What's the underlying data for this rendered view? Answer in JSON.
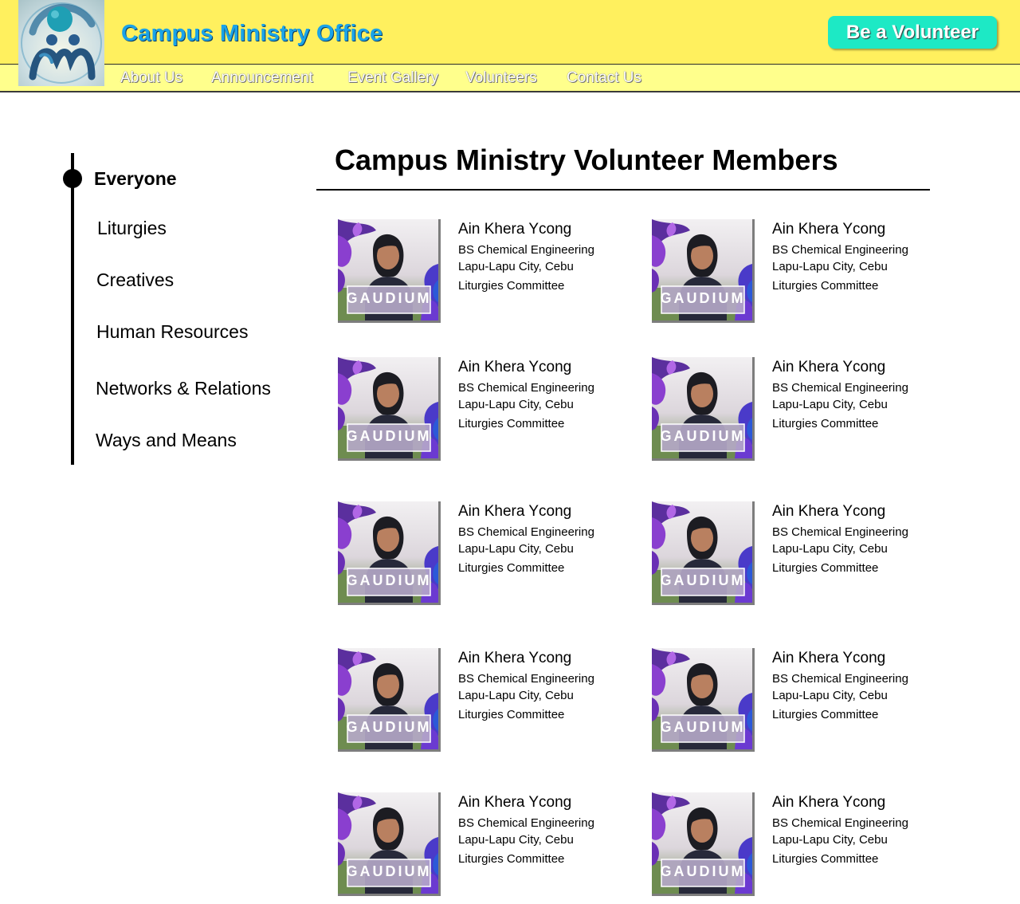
{
  "header": {
    "site_title": "Campus Ministry Office",
    "cta_label": "Be a Volunteer",
    "logo_icon": "campus-ministry-logo-icon"
  },
  "nav": [
    {
      "label": "About Us"
    },
    {
      "label": "Announcement"
    },
    {
      "label": "Event Gallery"
    },
    {
      "label": "Volunteers"
    },
    {
      "label": "Contact Us"
    }
  ],
  "sidebar": {
    "items": [
      {
        "label": "Everyone",
        "active": true
      },
      {
        "label": "Liturgies",
        "active": false
      },
      {
        "label": "Creatives",
        "active": false
      },
      {
        "label": "Human Resources",
        "active": false
      },
      {
        "label": "Networks & Relations",
        "active": false
      },
      {
        "label": "Ways and Means",
        "active": false
      }
    ]
  },
  "main": {
    "title": "Campus Ministry Volunteer Members",
    "members": [
      {
        "name": "Ain Khera Ycong",
        "course": "BS Chemical Engineering",
        "location": "Lapu-Lapu City, Cebu",
        "committee": "Liturgies Committee",
        "photo_caption": "GAUDIUM"
      },
      {
        "name": "Ain Khera Ycong",
        "course": "BS Chemical Engineering",
        "location": "Lapu-Lapu City, Cebu",
        "committee": "Liturgies Committee",
        "photo_caption": "GAUDIUM"
      },
      {
        "name": "Ain Khera Ycong",
        "course": "BS Chemical Engineering",
        "location": "Lapu-Lapu City, Cebu",
        "committee": "Liturgies Committee",
        "photo_caption": "GAUDIUM"
      },
      {
        "name": "Ain Khera Ycong",
        "course": "BS Chemical Engineering",
        "location": "Lapu-Lapu City, Cebu",
        "committee": "Liturgies Committee",
        "photo_caption": "GAUDIUM"
      },
      {
        "name": "Ain Khera Ycong",
        "course": "BS Chemical Engineering",
        "location": "Lapu-Lapu City, Cebu",
        "committee": "Liturgies Committee",
        "photo_caption": "GAUDIUM"
      },
      {
        "name": "Ain Khera Ycong",
        "course": "BS Chemical Engineering",
        "location": "Lapu-Lapu City, Cebu",
        "committee": "Liturgies Committee",
        "photo_caption": "GAUDIUM"
      },
      {
        "name": "Ain Khera Ycong",
        "course": "BS Chemical Engineering",
        "location": "Lapu-Lapu City, Cebu",
        "committee": "Liturgies Committee",
        "photo_caption": "GAUDIUM"
      },
      {
        "name": "Ain Khera Ycong",
        "course": "BS Chemical Engineering",
        "location": "Lapu-Lapu City, Cebu",
        "committee": "Liturgies Committee",
        "photo_caption": "GAUDIUM"
      },
      {
        "name": "Ain Khera Ycong",
        "course": "BS Chemical Engineering",
        "location": "Lapu-Lapu City, Cebu",
        "committee": "Liturgies Committee",
        "photo_caption": "GAUDIUM"
      },
      {
        "name": "Ain Khera Ycong",
        "course": "BS Chemical Engineering",
        "location": "Lapu-Lapu City, Cebu",
        "committee": "Liturgies Committee",
        "photo_caption": "GAUDIUM"
      }
    ]
  },
  "colors": {
    "header_bg": "#fff05e",
    "nav_bg": "#ffff8c",
    "title_blue": "#1aa3e8",
    "cta_teal": "#1de9c5"
  }
}
